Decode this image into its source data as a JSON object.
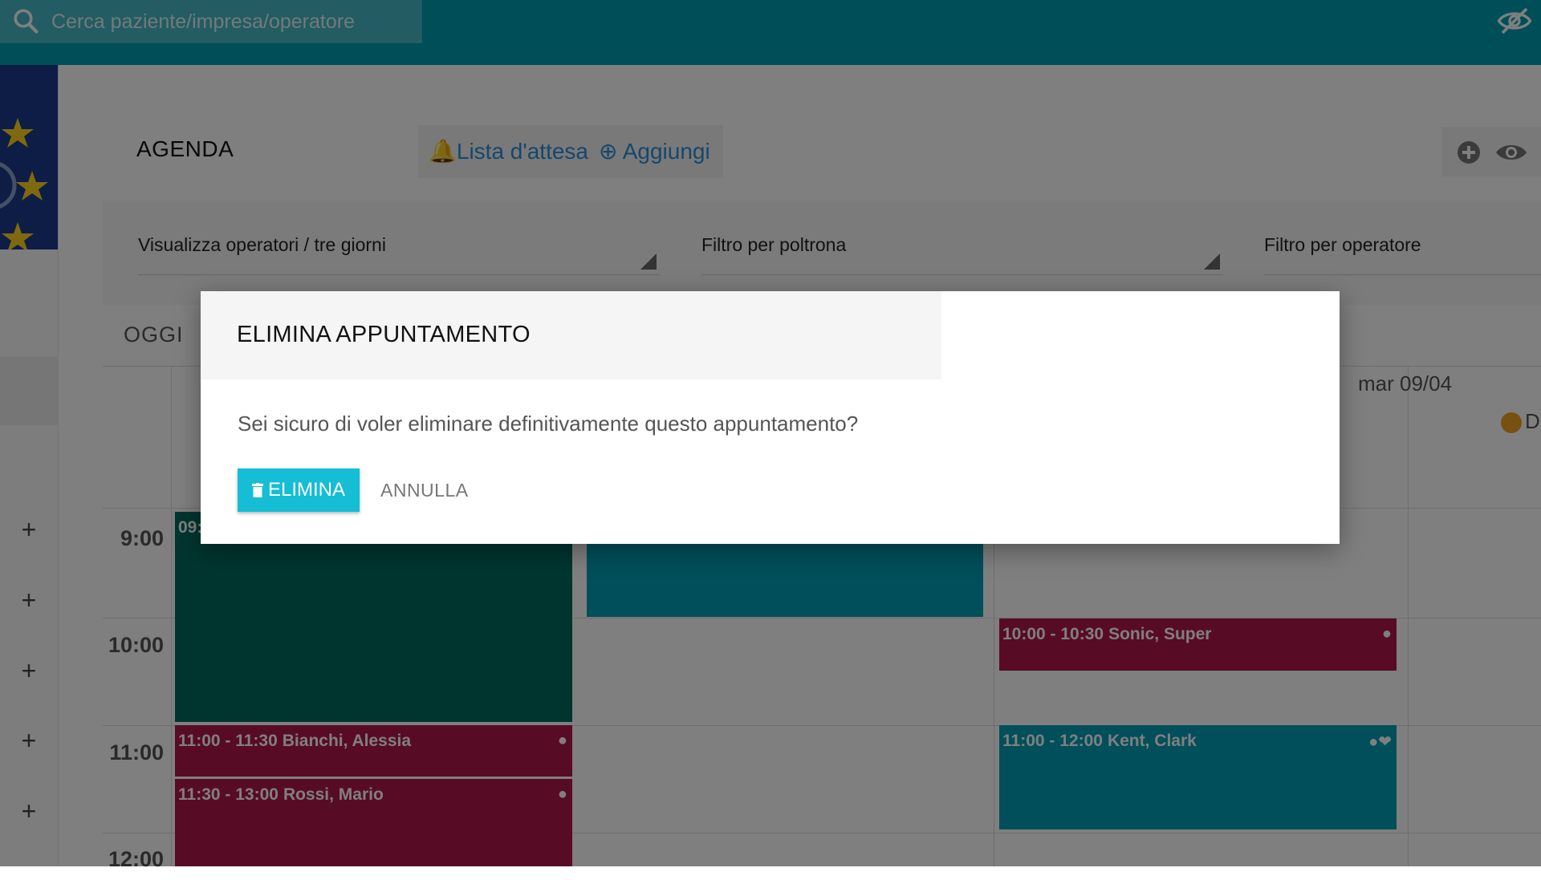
{
  "topbar": {
    "search_placeholder": "Cerca paziente/impresa/operatore",
    "search_icon": "search-icon",
    "visibility_icon": "eye-off-icon",
    "color": "#009fb0"
  },
  "sidebar": {
    "add_icon": "plus-icon",
    "add_buttons": [
      "+",
      "+",
      "+",
      "+",
      "+"
    ]
  },
  "agenda": {
    "title": "AGENDA",
    "waitlist_label": "Lista d'attesa",
    "add_label": "Aggiungi",
    "view_select": "Visualizza operatori / tre giorni",
    "chair_filter": "Filtro per poltrona",
    "operator_filter": "Filtro per operatore",
    "today_button": "OGGI",
    "date_header": "mar 09/04",
    "operator_initial": "D",
    "times": [
      "9:00",
      "10:00",
      "11:00",
      "12:00"
    ],
    "events": [
      {
        "time": "09:",
        "name": "",
        "color": "#006b5e"
      },
      {
        "time": "",
        "name": "",
        "color": "#009fb4"
      },
      {
        "time": "10:00 - 10:30",
        "name": "Sonic, Super",
        "color": "#b0174a"
      },
      {
        "time": "11:00 - 11:30",
        "name": "Bianchi, Alessia",
        "color": "#b0174a"
      },
      {
        "time": "11:30 - 13:00",
        "name": "Rossi, Mario",
        "color": "#b0174a"
      },
      {
        "time": "11:00 - 12:00",
        "name": "Kent, Clark",
        "color": "#009fb4"
      }
    ]
  },
  "modal": {
    "title": "ELIMINA APPUNTAMENTO",
    "message": "Sei sicuro di voler eliminare definitivamente questo appuntamento?",
    "delete_label": "ELIMINA",
    "cancel_label": "ANNULLA",
    "accent": "#15bdd5"
  }
}
